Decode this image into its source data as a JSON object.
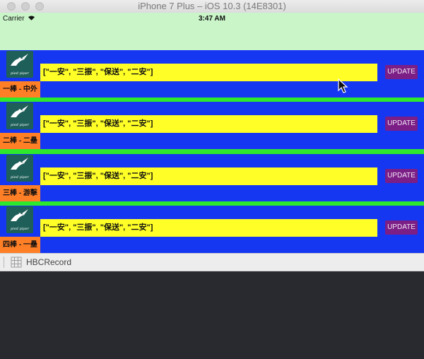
{
  "window": {
    "title": "iPhone 7 Plus – iOS 10.3 (14E8301)"
  },
  "statusbar": {
    "carrier": "Carrier",
    "time": "3:47 AM",
    "wifi_icon": "wifi-icon"
  },
  "colors": {
    "row_bg": "#1537f2",
    "separator": "#2ee82e",
    "nav_bg": "#c9f5c9",
    "label_bg": "#ff7f27",
    "field_bg": "#ffff27",
    "button_bg": "#7b1e86"
  },
  "rows": [
    {
      "logo_text": "pied piper",
      "name": "一棒 - 中外",
      "value": "[\"一安\", \"三振\", \"保送\", \"二安\"]",
      "button": "UPDATE"
    },
    {
      "logo_text": "pied piper",
      "name": "二棒 - 二壘",
      "value": "[\"一安\", \"三振\", \"保送\", \"二安\"]",
      "button": "UPDATE"
    },
    {
      "logo_text": "pied piper",
      "name": "三棒 - 游擊",
      "value": "[\"一安\", \"三振\", \"保送\", \"二安\"]",
      "button": "UPDATE"
    },
    {
      "logo_text": "pied piper",
      "name": "四棒 - 一壘",
      "value": "[\"一安\", \"三振\", \"保送\", \"二安\"]",
      "button": "UPDATE"
    }
  ],
  "debugbar": {
    "target_label": "HBCRecord",
    "target_icon": "grid-icon"
  }
}
